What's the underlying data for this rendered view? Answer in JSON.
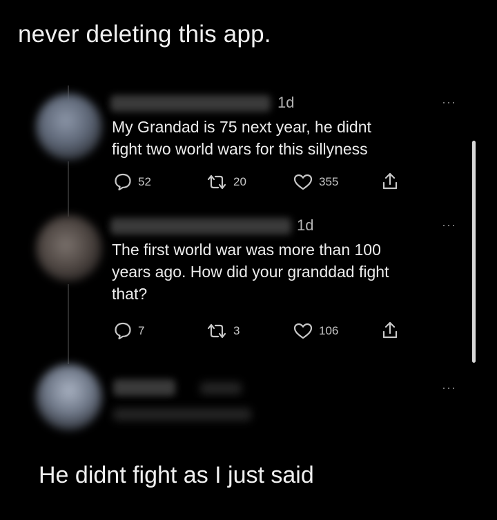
{
  "caption_top": "never deleting this app.",
  "caption_bottom": "He didnt fight as I just said",
  "tweets": [
    {
      "time": "1d",
      "more": "···",
      "lines": [
        "My Grandad is 75 next year,  he didnt",
        "fight two world wars for this sillyness"
      ],
      "replies": "52",
      "retweets": "20",
      "likes": "355"
    },
    {
      "time": "1d",
      "more": "···",
      "lines": [
        "The first world war was more than 100",
        "years ago. How did your granddad fight",
        "that?"
      ],
      "replies": "7",
      "retweets": "3",
      "likes": "106"
    },
    {
      "more": "···"
    }
  ],
  "icons": {
    "reply": "speech-bubble-icon",
    "retweet": "retweet-icon",
    "like": "heart-icon",
    "share": "share-icon"
  },
  "colors": {
    "background": "#000000",
    "text": "#ececec",
    "muted": "#b4b4b4"
  }
}
